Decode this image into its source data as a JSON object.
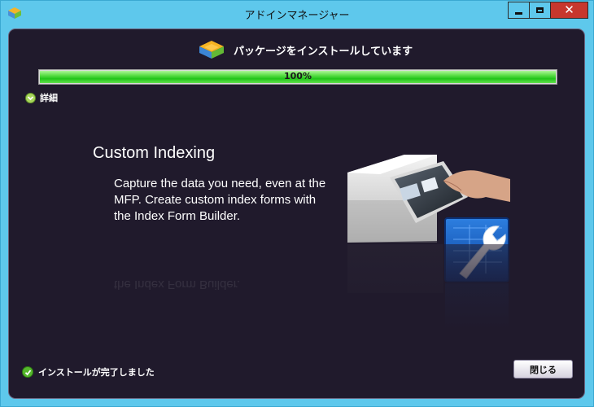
{
  "window": {
    "title": "アドインマネージャー",
    "controls": {
      "minimize": "minimize",
      "maximize": "maximize",
      "close": "✕"
    }
  },
  "header": {
    "text": "パッケージをインストールしています",
    "icon": "package-stack-icon"
  },
  "progress": {
    "value": 1.0,
    "label": "100%"
  },
  "details": {
    "label": "詳細",
    "icon": "chevron-down-icon"
  },
  "feature": {
    "title": "Custom Indexing",
    "description_lines": [
      "Capture the data you need, even at the",
      "MFP. Create custom index forms with",
      "the Index Form Builder."
    ],
    "image": "mfp-touchscreen-with-wrench-form-icon"
  },
  "status": {
    "text": "インストールが完了しました",
    "icon": "check-circle-icon"
  },
  "buttons": {
    "close_label": "閉じる"
  },
  "colors": {
    "titlebar": "#5ec8ec",
    "content_bg": "#201a2c",
    "progress_fill": "#22c51a",
    "close_control": "#c7372d"
  }
}
